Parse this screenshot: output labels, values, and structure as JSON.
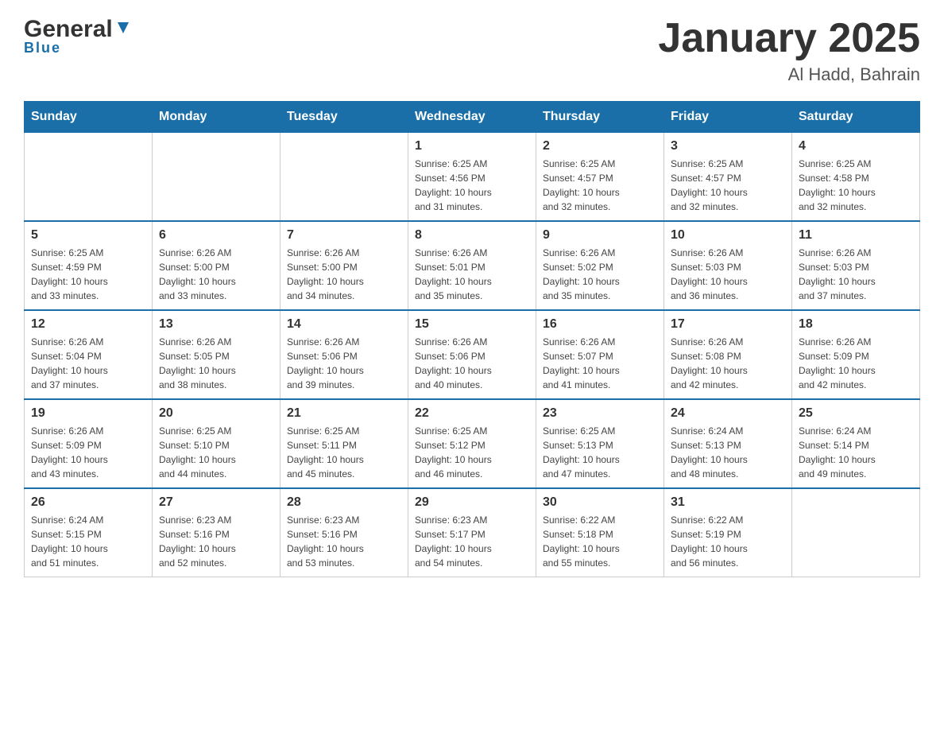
{
  "header": {
    "logo_general": "General",
    "logo_blue": "Blue",
    "month_title": "January 2025",
    "location": "Al Hadd, Bahrain"
  },
  "days_of_week": [
    "Sunday",
    "Monday",
    "Tuesday",
    "Wednesday",
    "Thursday",
    "Friday",
    "Saturday"
  ],
  "weeks": [
    [
      {
        "day": "",
        "info": ""
      },
      {
        "day": "",
        "info": ""
      },
      {
        "day": "",
        "info": ""
      },
      {
        "day": "1",
        "info": "Sunrise: 6:25 AM\nSunset: 4:56 PM\nDaylight: 10 hours\nand 31 minutes."
      },
      {
        "day": "2",
        "info": "Sunrise: 6:25 AM\nSunset: 4:57 PM\nDaylight: 10 hours\nand 32 minutes."
      },
      {
        "day": "3",
        "info": "Sunrise: 6:25 AM\nSunset: 4:57 PM\nDaylight: 10 hours\nand 32 minutes."
      },
      {
        "day": "4",
        "info": "Sunrise: 6:25 AM\nSunset: 4:58 PM\nDaylight: 10 hours\nand 32 minutes."
      }
    ],
    [
      {
        "day": "5",
        "info": "Sunrise: 6:25 AM\nSunset: 4:59 PM\nDaylight: 10 hours\nand 33 minutes."
      },
      {
        "day": "6",
        "info": "Sunrise: 6:26 AM\nSunset: 5:00 PM\nDaylight: 10 hours\nand 33 minutes."
      },
      {
        "day": "7",
        "info": "Sunrise: 6:26 AM\nSunset: 5:00 PM\nDaylight: 10 hours\nand 34 minutes."
      },
      {
        "day": "8",
        "info": "Sunrise: 6:26 AM\nSunset: 5:01 PM\nDaylight: 10 hours\nand 35 minutes."
      },
      {
        "day": "9",
        "info": "Sunrise: 6:26 AM\nSunset: 5:02 PM\nDaylight: 10 hours\nand 35 minutes."
      },
      {
        "day": "10",
        "info": "Sunrise: 6:26 AM\nSunset: 5:03 PM\nDaylight: 10 hours\nand 36 minutes."
      },
      {
        "day": "11",
        "info": "Sunrise: 6:26 AM\nSunset: 5:03 PM\nDaylight: 10 hours\nand 37 minutes."
      }
    ],
    [
      {
        "day": "12",
        "info": "Sunrise: 6:26 AM\nSunset: 5:04 PM\nDaylight: 10 hours\nand 37 minutes."
      },
      {
        "day": "13",
        "info": "Sunrise: 6:26 AM\nSunset: 5:05 PM\nDaylight: 10 hours\nand 38 minutes."
      },
      {
        "day": "14",
        "info": "Sunrise: 6:26 AM\nSunset: 5:06 PM\nDaylight: 10 hours\nand 39 minutes."
      },
      {
        "day": "15",
        "info": "Sunrise: 6:26 AM\nSunset: 5:06 PM\nDaylight: 10 hours\nand 40 minutes."
      },
      {
        "day": "16",
        "info": "Sunrise: 6:26 AM\nSunset: 5:07 PM\nDaylight: 10 hours\nand 41 minutes."
      },
      {
        "day": "17",
        "info": "Sunrise: 6:26 AM\nSunset: 5:08 PM\nDaylight: 10 hours\nand 42 minutes."
      },
      {
        "day": "18",
        "info": "Sunrise: 6:26 AM\nSunset: 5:09 PM\nDaylight: 10 hours\nand 42 minutes."
      }
    ],
    [
      {
        "day": "19",
        "info": "Sunrise: 6:26 AM\nSunset: 5:09 PM\nDaylight: 10 hours\nand 43 minutes."
      },
      {
        "day": "20",
        "info": "Sunrise: 6:25 AM\nSunset: 5:10 PM\nDaylight: 10 hours\nand 44 minutes."
      },
      {
        "day": "21",
        "info": "Sunrise: 6:25 AM\nSunset: 5:11 PM\nDaylight: 10 hours\nand 45 minutes."
      },
      {
        "day": "22",
        "info": "Sunrise: 6:25 AM\nSunset: 5:12 PM\nDaylight: 10 hours\nand 46 minutes."
      },
      {
        "day": "23",
        "info": "Sunrise: 6:25 AM\nSunset: 5:13 PM\nDaylight: 10 hours\nand 47 minutes."
      },
      {
        "day": "24",
        "info": "Sunrise: 6:24 AM\nSunset: 5:13 PM\nDaylight: 10 hours\nand 48 minutes."
      },
      {
        "day": "25",
        "info": "Sunrise: 6:24 AM\nSunset: 5:14 PM\nDaylight: 10 hours\nand 49 minutes."
      }
    ],
    [
      {
        "day": "26",
        "info": "Sunrise: 6:24 AM\nSunset: 5:15 PM\nDaylight: 10 hours\nand 51 minutes."
      },
      {
        "day": "27",
        "info": "Sunrise: 6:23 AM\nSunset: 5:16 PM\nDaylight: 10 hours\nand 52 minutes."
      },
      {
        "day": "28",
        "info": "Sunrise: 6:23 AM\nSunset: 5:16 PM\nDaylight: 10 hours\nand 53 minutes."
      },
      {
        "day": "29",
        "info": "Sunrise: 6:23 AM\nSunset: 5:17 PM\nDaylight: 10 hours\nand 54 minutes."
      },
      {
        "day": "30",
        "info": "Sunrise: 6:22 AM\nSunset: 5:18 PM\nDaylight: 10 hours\nand 55 minutes."
      },
      {
        "day": "31",
        "info": "Sunrise: 6:22 AM\nSunset: 5:19 PM\nDaylight: 10 hours\nand 56 minutes."
      },
      {
        "day": "",
        "info": ""
      }
    ]
  ]
}
